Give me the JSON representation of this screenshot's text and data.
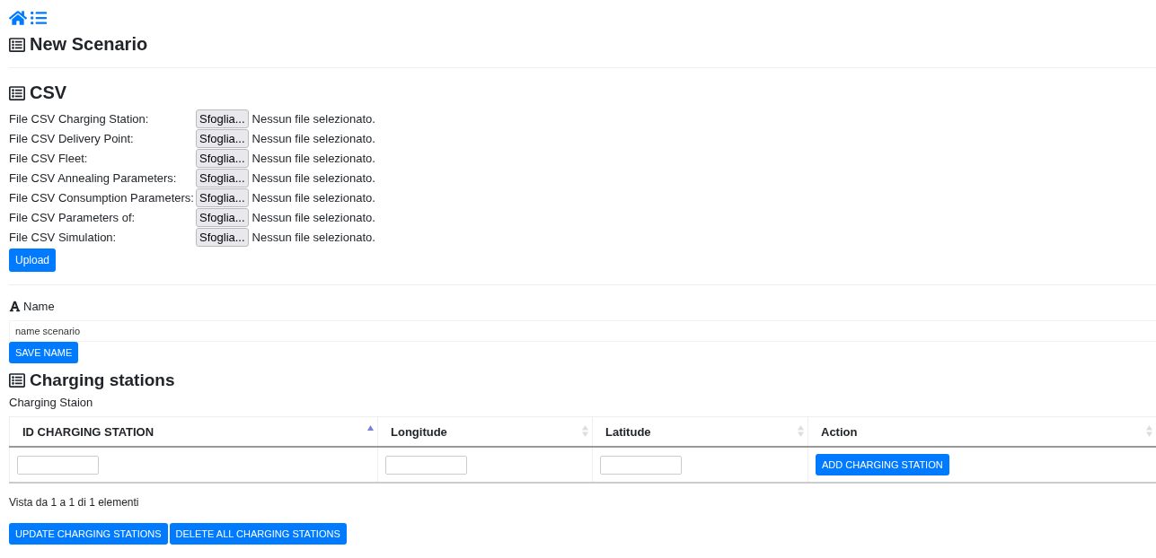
{
  "title": "New Scenario",
  "csv": {
    "title": "CSV",
    "files": [
      {
        "label": "File CSV Charging Station:",
        "button": "Sfoglia...",
        "status": "Nessun file selezionato."
      },
      {
        "label": "File CSV Delivery Point:",
        "button": "Sfoglia...",
        "status": "Nessun file selezionato."
      },
      {
        "label": "File CSV Fleet:",
        "button": "Sfoglia...",
        "status": "Nessun file selezionato."
      },
      {
        "label": "File CSV Annealing Parameters:",
        "button": "Sfoglia...",
        "status": "Nessun file selezionato."
      },
      {
        "label": "File CSV Consumption Parameters:",
        "button": "Sfoglia...",
        "status": "Nessun file selezionato."
      },
      {
        "label": "File CSV Parameters of:",
        "button": "Sfoglia...",
        "status": "Nessun file selezionato."
      },
      {
        "label": "File CSV Simulation:",
        "button": "Sfoglia...",
        "status": "Nessun file selezionato."
      }
    ],
    "upload": "Upload"
  },
  "name": {
    "label": "Name",
    "value": "name scenario",
    "save": "SAVE NAME"
  },
  "stations": {
    "title": "Charging stations",
    "caption": "Charging Staion",
    "columns": [
      {
        "label": "ID CHARGING STATION",
        "sorted": true
      },
      {
        "label": "Longitude",
        "sorted": false
      },
      {
        "label": "Latitude",
        "sorted": false
      },
      {
        "label": "Action",
        "sorted": false
      }
    ],
    "add": "ADD CHARGING STATION",
    "info": "Vista da 1 a 1 di 1 elementi",
    "buttons": [
      "UPDATE CHARGING STATIONS",
      "DELETE ALL CHARGING STATIONS"
    ]
  }
}
